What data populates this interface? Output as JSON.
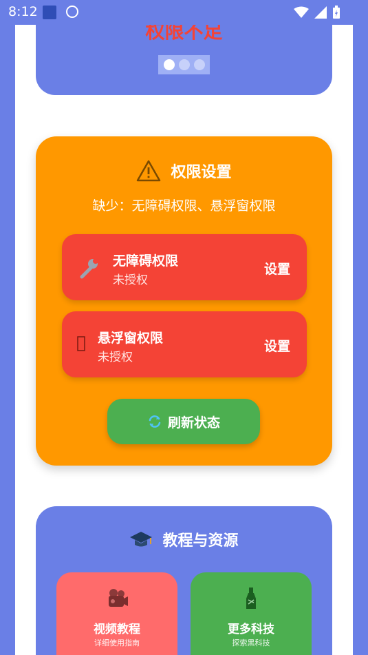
{
  "status_bar": {
    "time": "8:12"
  },
  "top_banner": {
    "title": "权限不足",
    "pager_dots": 3,
    "active_dot": 1
  },
  "permissions_card": {
    "title": "权限设置",
    "missing_text": "缺少：无障碍权限、悬浮窗权限",
    "items": [
      {
        "name": "无障碍权限",
        "state": "未授权",
        "action": "设置",
        "icon": "wrench-icon"
      },
      {
        "name": "悬浮窗权限",
        "state": "未授权",
        "action": "设置",
        "icon": "window-icon"
      }
    ],
    "refresh_label": "刷新状态"
  },
  "resources_card": {
    "title": "教程与资源",
    "tiles": [
      {
        "name": "视频教程",
        "subtitle": "详细使用指南",
        "icon": "video-camera-icon",
        "color": "#FF6B6B"
      },
      {
        "name": "更多科技",
        "subtitle": "探索黑科技",
        "icon": "bottle-icon",
        "color": "#4CAF50"
      }
    ]
  },
  "colors": {
    "primary": "#6A7FE6",
    "warning": "#FF9800",
    "danger": "#F44336",
    "success": "#4CAF50"
  }
}
